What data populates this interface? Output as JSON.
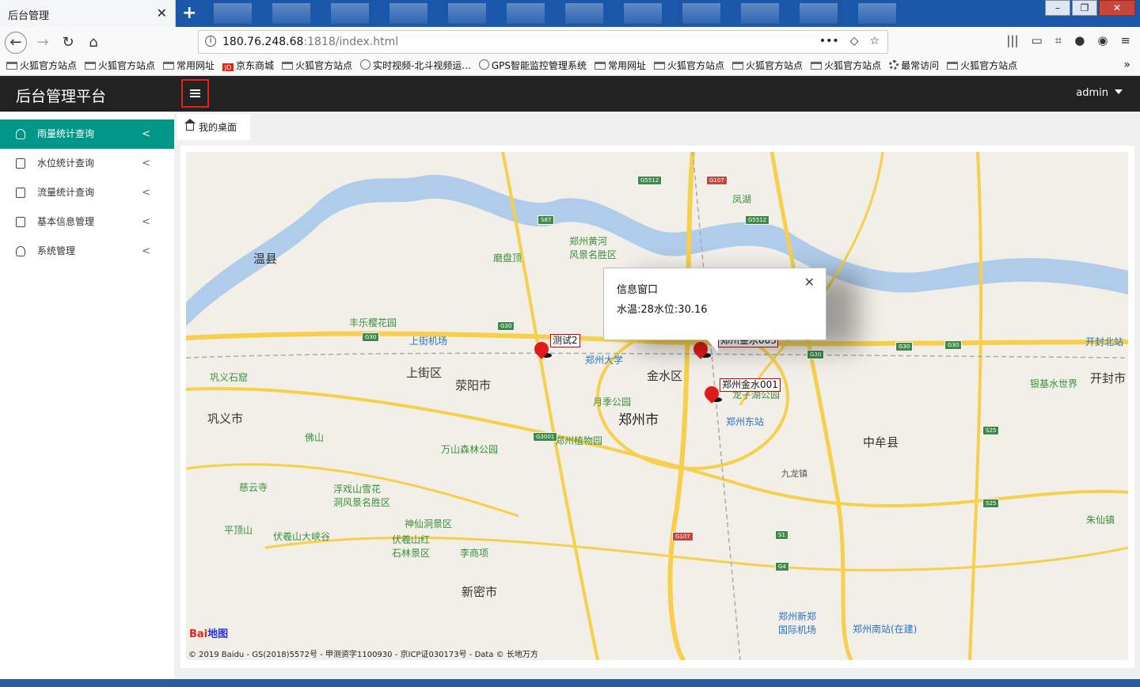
{
  "browser": {
    "tab_title": "后台管理",
    "tab_close": "✕",
    "new_tab": "+",
    "url_host": "180.76.248.68",
    "url_path": ":1818/index.html",
    "url_more": "•••",
    "bookmarks": [
      {
        "label": "火狐官方站点",
        "icon": "folder"
      },
      {
        "label": "火狐官方站点",
        "icon": "folder"
      },
      {
        "label": "常用网址",
        "icon": "folder"
      },
      {
        "label": "京东商城",
        "icon": "jd"
      },
      {
        "label": "火狐官方站点",
        "icon": "folder"
      },
      {
        "label": "实时视频-北斗视频运...",
        "icon": "globe"
      },
      {
        "label": "GPS智能监控管理系统",
        "icon": "globe"
      },
      {
        "label": "常用网址",
        "icon": "folder"
      },
      {
        "label": "火狐官方站点",
        "icon": "folder"
      },
      {
        "label": "火狐官方站点",
        "icon": "folder"
      },
      {
        "label": "火狐官方站点",
        "icon": "folder"
      },
      {
        "label": "最常访问",
        "icon": "gear"
      },
      {
        "label": "火狐官方站点",
        "icon": "folder"
      }
    ],
    "bookmarks_more": "»"
  },
  "header": {
    "title": "后台管理平台",
    "user": "admin"
  },
  "sidebar": {
    "items": [
      {
        "label": "雨量统计查询",
        "icon": "person-icon",
        "active": true
      },
      {
        "label": "水位统计查询",
        "icon": "document-icon",
        "active": false
      },
      {
        "label": "流量统计查询",
        "icon": "document-icon",
        "active": false
      },
      {
        "label": "基本信息管理",
        "icon": "document-icon",
        "active": false
      },
      {
        "label": "系统管理",
        "icon": "person-icon",
        "active": false
      }
    ],
    "chevron": "<"
  },
  "content": {
    "tab_label": "我的桌面"
  },
  "map": {
    "markers": [
      {
        "label": "测试2"
      },
      {
        "label": "郑州金水003"
      },
      {
        "label": "郑州金水001"
      }
    ],
    "info_window": {
      "title": "信息窗口",
      "body": "水温:28水位:30.16",
      "close": "✕"
    },
    "labels": {
      "zhengzhou": "郑州市",
      "xingyang": "荥阳市",
      "gongyi": "巩义市",
      "zhongmou": "中牟县",
      "xinmi": "新密市",
      "jinshui": "金水区",
      "shangjie": "上街区",
      "wenxian": "温县",
      "kaifeng": "开封市",
      "yinji": "银基水世界",
      "airport": "上街机场",
      "zzu": "郑州大学",
      "zzeast": "郑州东站",
      "xinzheng_airport": "郑州新郑\n国际机场",
      "zz_south": "郑州南站(在建)",
      "kaifeng_north": "开封北站",
      "huanghe": "郑州黄河\n风景名胜区",
      "fenghu": "凤湖",
      "yuejihu": "月季公园",
      "botanic": "郑州植物园",
      "wanshan": "万山森林公园",
      "fushan": "浮戏山雪花\n洞风景名胜区",
      "shenxian": "神仙洞景区",
      "fuxishan": "伏羲山红\n石林景区",
      "lishu": "李商项",
      "cigong": "慈云寺",
      "pingding": "平顶山",
      "foshan": "佛山",
      "fengle": "丰乐樱花园",
      "mopan": "磨盘顶",
      "zhuxian": "朱仙镇",
      "gongyi_stone": "巩义石窟",
      "fuxi_valley": "伏羲山大峡谷",
      "longzi": "龙子湖公园",
      "jiulong": "九龙镇"
    },
    "copyright": "© 2019 Baidu - GS(2018)5572号 - 甲测资字1100930 - 京ICP证030173号 - Data © 长地万方",
    "logo": "Bai地图"
  },
  "colors": {
    "sidebar_active": "#009688",
    "header_bg": "#222222",
    "highlight_border": "#e2231a",
    "marker": "#e01b1b"
  }
}
